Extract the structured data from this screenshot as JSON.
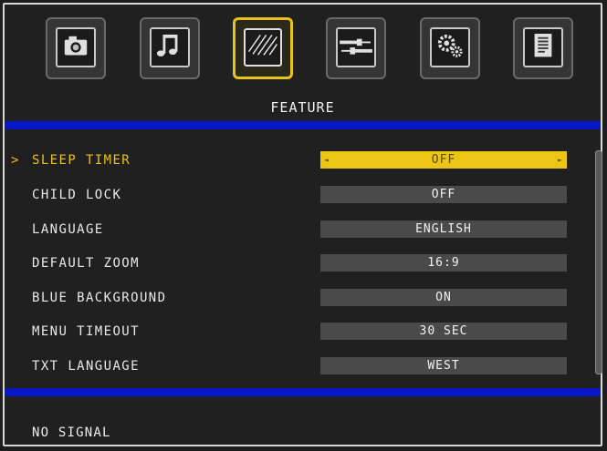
{
  "header": {
    "tabs": [
      {
        "icon": "camera-icon",
        "active": false
      },
      {
        "icon": "music-note-icon",
        "active": false
      },
      {
        "icon": "feature-stripes-icon",
        "active": true
      },
      {
        "icon": "cable-connector-icon",
        "active": false
      },
      {
        "icon": "gears-icon",
        "active": false
      },
      {
        "icon": "document-icon",
        "active": false
      }
    ],
    "title": "FEATURE"
  },
  "menu": {
    "items": [
      {
        "label": "SLEEP TIMER",
        "value": "OFF",
        "selected": true
      },
      {
        "label": "CHILD LOCK",
        "value": "OFF"
      },
      {
        "label": "LANGUAGE",
        "value": "ENGLISH"
      },
      {
        "label": "DEFAULT ZOOM",
        "value": "16:9"
      },
      {
        "label": "BLUE BACKGROUND",
        "value": "ON"
      },
      {
        "label": "MENU TIMEOUT",
        "value": "30 SEC"
      },
      {
        "label": "TXT LANGUAGE",
        "value": "WEST"
      }
    ],
    "cursor": ">",
    "arrow_left": "◄",
    "arrow_right": "►"
  },
  "status": {
    "text": "NO SIGNAL"
  },
  "colors": {
    "accent": "#e9c21b",
    "bar": "#0818c8",
    "background": "#1e1e1e",
    "value_bg": "#4a4a4a"
  }
}
